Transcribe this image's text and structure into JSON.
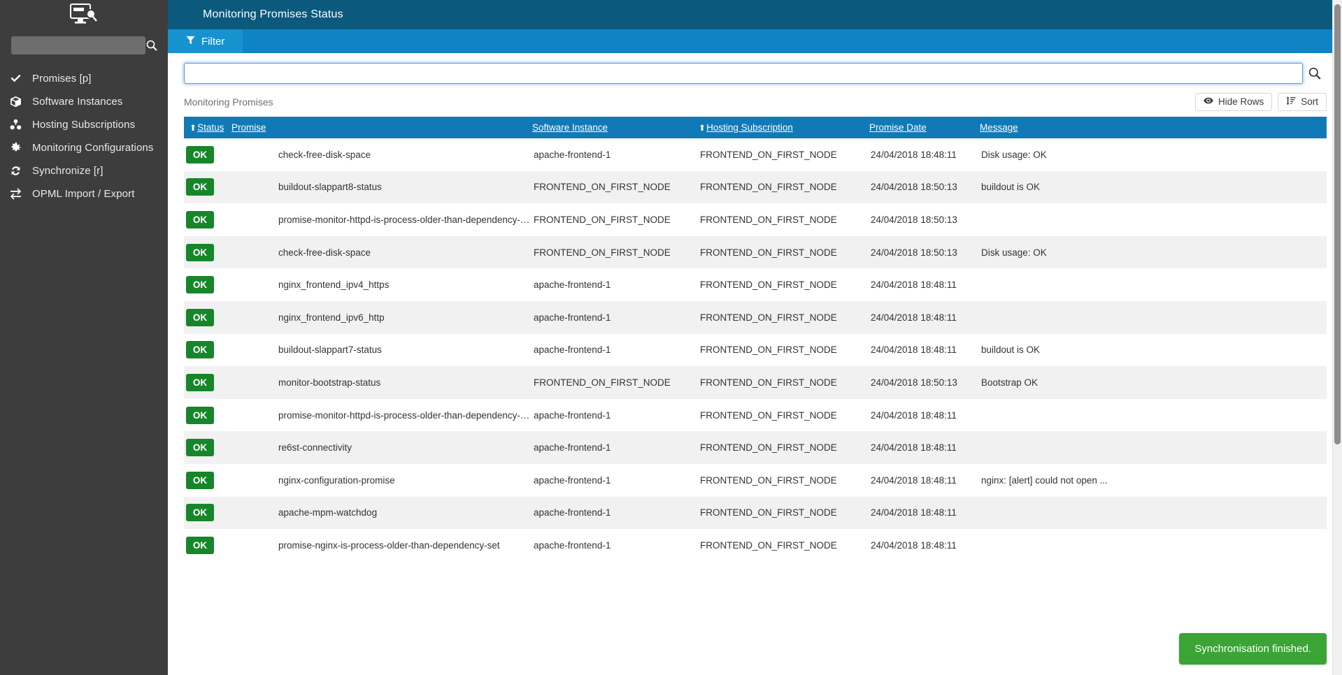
{
  "sidebar": {
    "logo_icon": "monitor-search-icon",
    "search": {
      "value": "",
      "placeholder": "",
      "icon": "search-icon"
    },
    "items": [
      {
        "label": "Promises [p]",
        "icon": "check-icon"
      },
      {
        "label": "Software Instances",
        "icon": "box-icon"
      },
      {
        "label": "Hosting Subscriptions",
        "icon": "cubes-icon"
      },
      {
        "label": "Monitoring Configurations",
        "icon": "gear-icon"
      },
      {
        "label": "Synchronize [r]",
        "icon": "refresh-icon"
      },
      {
        "label": "OPML Import / Export",
        "icon": "exchange-icon"
      }
    ]
  },
  "header": {
    "title": "Monitoring Promises Status"
  },
  "tabs": [
    {
      "label": "Filter",
      "icon": "filter-icon",
      "active": true
    }
  ],
  "search": {
    "value": "",
    "placeholder": "",
    "submit_icon": "search-icon"
  },
  "table_caption": "Monitoring Promises",
  "toolbar": {
    "hide_rows_label": "Hide Rows",
    "hide_rows_icon": "eye-icon",
    "sort_label": "Sort",
    "sort_icon": "sort-amount-icon"
  },
  "table": {
    "columns": [
      {
        "label": "Status",
        "sorted": true,
        "sort_dir": "asc"
      },
      {
        "label": "Promise",
        "sorted": false,
        "sort_dir": ""
      },
      {
        "label": "Software Instance",
        "sorted": false,
        "sort_dir": ""
      },
      {
        "label": "Hosting Subscription",
        "sorted": true,
        "sort_dir": "asc"
      },
      {
        "label": "Promise Date",
        "sorted": false,
        "sort_dir": ""
      },
      {
        "label": "Message",
        "sorted": false,
        "sort_dir": ""
      }
    ],
    "rows": [
      {
        "status": "OK",
        "promise": "check-free-disk-space",
        "software_instance": "apache-frontend-1",
        "hosting_subscription": "FRONTEND_ON_FIRST_NODE",
        "promise_date": "24/04/2018 18:48:11",
        "message": "Disk usage: OK"
      },
      {
        "status": "OK",
        "promise": "buildout-slappart8-status",
        "software_instance": "FRONTEND_ON_FIRST_NODE",
        "hosting_subscription": "FRONTEND_ON_FIRST_NODE",
        "promise_date": "24/04/2018 18:50:13",
        "message": "buildout is OK"
      },
      {
        "status": "OK",
        "promise": "promise-monitor-httpd-is-process-older-than-dependency-set",
        "software_instance": "FRONTEND_ON_FIRST_NODE",
        "hosting_subscription": "FRONTEND_ON_FIRST_NODE",
        "promise_date": "24/04/2018 18:50:13",
        "message": ""
      },
      {
        "status": "OK",
        "promise": "check-free-disk-space",
        "software_instance": "FRONTEND_ON_FIRST_NODE",
        "hosting_subscription": "FRONTEND_ON_FIRST_NODE",
        "promise_date": "24/04/2018 18:50:13",
        "message": "Disk usage: OK"
      },
      {
        "status": "OK",
        "promise": "nginx_frontend_ipv4_https",
        "software_instance": "apache-frontend-1",
        "hosting_subscription": "FRONTEND_ON_FIRST_NODE",
        "promise_date": "24/04/2018 18:48:11",
        "message": ""
      },
      {
        "status": "OK",
        "promise": "nginx_frontend_ipv6_http",
        "software_instance": "apache-frontend-1",
        "hosting_subscription": "FRONTEND_ON_FIRST_NODE",
        "promise_date": "24/04/2018 18:48:11",
        "message": ""
      },
      {
        "status": "OK",
        "promise": "buildout-slappart7-status",
        "software_instance": "apache-frontend-1",
        "hosting_subscription": "FRONTEND_ON_FIRST_NODE",
        "promise_date": "24/04/2018 18:48:11",
        "message": "buildout is OK"
      },
      {
        "status": "OK",
        "promise": "monitor-bootstrap-status",
        "software_instance": "FRONTEND_ON_FIRST_NODE",
        "hosting_subscription": "FRONTEND_ON_FIRST_NODE",
        "promise_date": "24/04/2018 18:50:13",
        "message": "Bootstrap OK"
      },
      {
        "status": "OK",
        "promise": "promise-monitor-httpd-is-process-older-than-dependency-set",
        "software_instance": "apache-frontend-1",
        "hosting_subscription": "FRONTEND_ON_FIRST_NODE",
        "promise_date": "24/04/2018 18:48:11",
        "message": ""
      },
      {
        "status": "OK",
        "promise": "re6st-connectivity",
        "software_instance": "apache-frontend-1",
        "hosting_subscription": "FRONTEND_ON_FIRST_NODE",
        "promise_date": "24/04/2018 18:48:11",
        "message": ""
      },
      {
        "status": "OK",
        "promise": "nginx-configuration-promise",
        "software_instance": "apache-frontend-1",
        "hosting_subscription": "FRONTEND_ON_FIRST_NODE",
        "promise_date": "24/04/2018 18:48:11",
        "message": "nginx: [alert] could not open ..."
      },
      {
        "status": "OK",
        "promise": "apache-mpm-watchdog",
        "software_instance": "apache-frontend-1",
        "hosting_subscription": "FRONTEND_ON_FIRST_NODE",
        "promise_date": "24/04/2018 18:48:11",
        "message": ""
      },
      {
        "status": "OK",
        "promise": "promise-nginx-is-process-older-than-dependency-set",
        "software_instance": "apache-frontend-1",
        "hosting_subscription": "FRONTEND_ON_FIRST_NODE",
        "promise_date": "24/04/2018 18:48:11",
        "message": ""
      }
    ]
  },
  "toast": {
    "message": "Synchronisation finished."
  },
  "colors": {
    "sidebar_bg": "#3d3d3d",
    "header_bg": "#0b5a7e",
    "tabbar_bg": "#0e84c4",
    "tab_active_bg": "#1693cf",
    "table_header_bg": "#1179b5",
    "status_ok": "#17862a",
    "toast_bg": "#3aa435"
  }
}
